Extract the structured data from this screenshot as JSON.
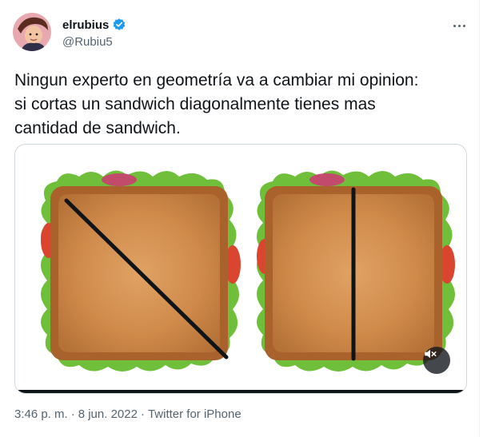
{
  "user": {
    "display_name": "elrubius",
    "handle": "@Rubiu5",
    "verified": true
  },
  "tweet": {
    "text": "Ningun experto en geometría va a cambiar mi opinion:\nsi cortas un sandwich diagonalmente tienes mas\ncantidad de sandwich."
  },
  "media": {
    "type": "video",
    "muted": true,
    "progress": 1.0
  },
  "meta": {
    "time": "3:46 p. m.",
    "separator": "·",
    "date": "8 jun. 2022",
    "source": "Twitter for iPhone"
  },
  "colors": {
    "text": "#0f1419",
    "secondary": "#536471",
    "verified": "#1d9bf0",
    "border": "#cfd9de",
    "toast": "#c9894a",
    "crust": "#b06a2e",
    "lettuce": "#6fbf3b",
    "tomato": "#d9452f"
  },
  "icons": {
    "verified": "verified-badge-icon",
    "more": "more-dots-icon",
    "mute": "speaker-muted-icon"
  }
}
